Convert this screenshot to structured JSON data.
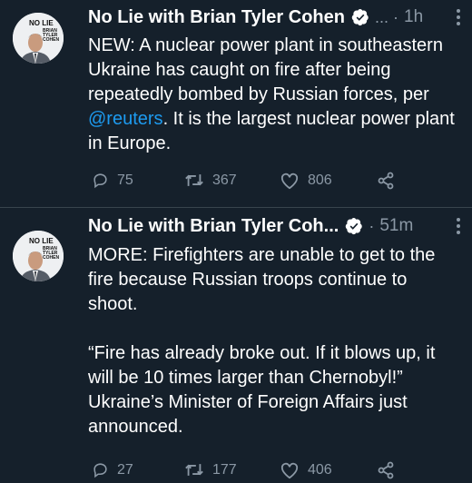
{
  "tweets": [
    {
      "avatar_text": [
        "NO LIE",
        "BRIAN",
        "TYLER",
        "COHEN"
      ],
      "author": "No Lie with Brian Tyler Cohen",
      "separator": "... ·",
      "time": "1h",
      "text_before": "NEW: A nuclear power plant in southeastern Ukraine has caught on fire after being repeatedly bombed by Russian forces, per ",
      "mention": "@reuters",
      "text_after": ". It is the largest nuclear power plant in Europe.",
      "replies": "75",
      "retweets": "367",
      "likes": "806"
    },
    {
      "avatar_text": [
        "NO LIE",
        "BRIAN",
        "TYLER",
        "COHEN"
      ],
      "author": "No Lie with Brian Tyler Coh...",
      "separator": "·",
      "time": "51m",
      "paragraph1": "MORE: Firefighters are unable to get to the fire because Russian troops continue to shoot.",
      "paragraph2": "“Fire has already broke out. If it blows up, it will be 10 times larger than Chernobyl!” Ukraine’s Minister of Foreign Affairs just announced.",
      "replies": "27",
      "retweets": "177",
      "likes": "406"
    }
  ],
  "colors": {
    "background": "#15202b",
    "muted": "#8b98a5",
    "link": "#1d9bf0"
  }
}
